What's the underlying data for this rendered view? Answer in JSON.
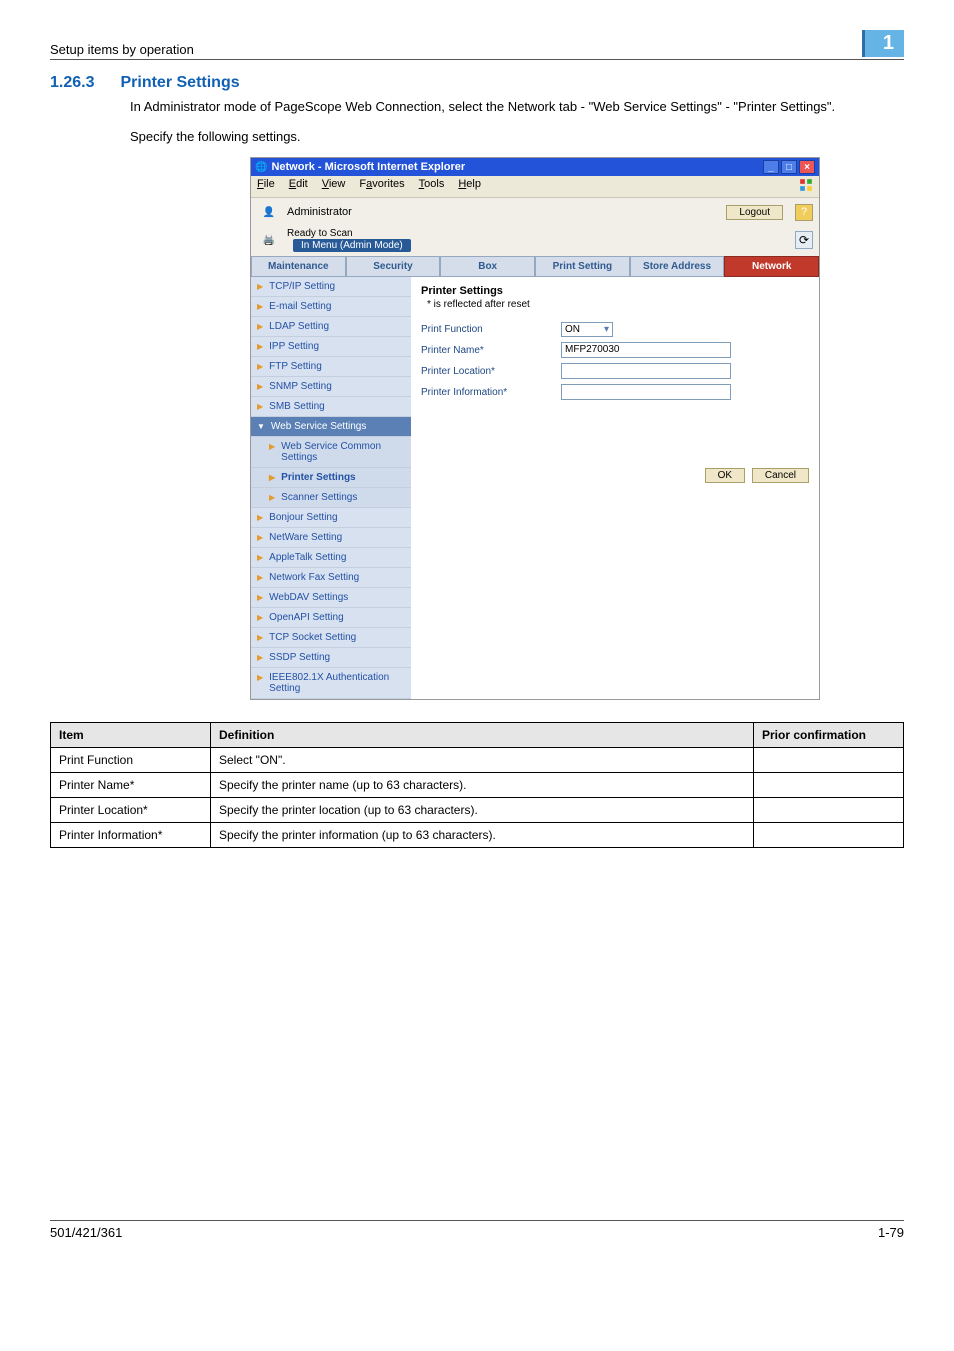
{
  "page": {
    "breadcrumb": "Setup items by operation",
    "chapter_badge": "1",
    "section_number": "1.26.3",
    "section_title": "Printer Settings",
    "intro_para": "In Administrator mode of PageScope Web Connection, select the Network tab - \"Web Service Settings\" - \"Printer Settings\".",
    "instruction": "Specify the following settings."
  },
  "screenshot": {
    "window_title": "Network - Microsoft Internet Explorer",
    "menubar": [
      "File",
      "Edit",
      "View",
      "Favorites",
      "Tools",
      "Help"
    ],
    "header": {
      "admin_label": "Administrator",
      "logout_btn": "Logout",
      "status_text": "Ready to Scan",
      "mode_pill": "In Menu (Admin Mode)"
    },
    "tabs": [
      "Maintenance",
      "Security",
      "Box",
      "Print Setting",
      "Store Address",
      "Network"
    ],
    "active_tab_index": 5,
    "sidebar": [
      {
        "label": "TCP/IP Setting",
        "type": "item"
      },
      {
        "label": "E-mail Setting",
        "type": "item"
      },
      {
        "label": "LDAP Setting",
        "type": "item"
      },
      {
        "label": "IPP Setting",
        "type": "item"
      },
      {
        "label": "FTP Setting",
        "type": "item"
      },
      {
        "label": "SNMP Setting",
        "type": "item"
      },
      {
        "label": "SMB Setting",
        "type": "item"
      },
      {
        "label": "Web Service Settings",
        "type": "expanded"
      },
      {
        "label": "Web Service Common Settings",
        "type": "sub"
      },
      {
        "label": "Printer Settings",
        "type": "sub-active"
      },
      {
        "label": "Scanner Settings",
        "type": "sub"
      },
      {
        "label": "Bonjour Setting",
        "type": "item"
      },
      {
        "label": "NetWare Setting",
        "type": "item"
      },
      {
        "label": "AppleTalk Setting",
        "type": "item"
      },
      {
        "label": "Network Fax Setting",
        "type": "item"
      },
      {
        "label": "WebDAV Settings",
        "type": "item"
      },
      {
        "label": "OpenAPI Setting",
        "type": "item"
      },
      {
        "label": "TCP Socket Setting",
        "type": "item"
      },
      {
        "label": "SSDP Setting",
        "type": "item"
      },
      {
        "label": "IEEE802.1X Authentication Setting",
        "type": "item"
      }
    ],
    "content": {
      "title": "Printer Settings",
      "note": "* is reflected after reset",
      "fields": [
        {
          "label": "Print Function",
          "control": "select",
          "value": "ON"
        },
        {
          "label": "Printer Name*",
          "control": "text",
          "value": "MFP270030"
        },
        {
          "label": "Printer Location*",
          "control": "text",
          "value": ""
        },
        {
          "label": "Printer Information*",
          "control": "text",
          "value": ""
        }
      ],
      "ok_btn": "OK",
      "cancel_btn": "Cancel"
    }
  },
  "table": {
    "headers": [
      "Item",
      "Definition",
      "Prior confirmation"
    ],
    "rows": [
      {
        "item": "Print Function",
        "def": "Select \"ON\".",
        "prior": ""
      },
      {
        "item": "Printer Name*",
        "def": "Specify the printer name (up to 63 characters).",
        "prior": ""
      },
      {
        "item": "Printer Location*",
        "def": "Specify the printer location (up to 63 characters).",
        "prior": ""
      },
      {
        "item": "Printer Information*",
        "def": "Specify the printer information (up to 63 characters).",
        "prior": ""
      }
    ]
  },
  "footer": {
    "left": "501/421/361",
    "right": "1-79"
  }
}
